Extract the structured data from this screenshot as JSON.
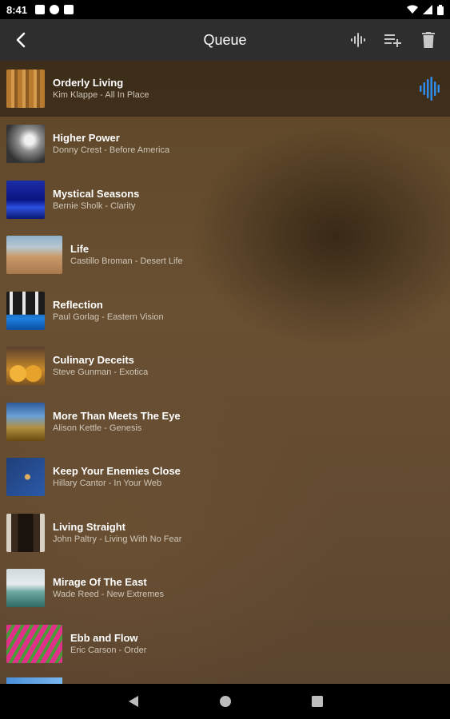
{
  "status": {
    "time": "8:41"
  },
  "appbar": {
    "title": "Queue"
  },
  "queue": [
    {
      "title": "Orderly Living",
      "subtitle": "Kim Klappe - All In Place",
      "current": true
    },
    {
      "title": "Higher Power",
      "subtitle": "Donny Crest - Before America"
    },
    {
      "title": "Mystical Seasons",
      "subtitle": "Bernie Sholk - Clarity"
    },
    {
      "title": "Life",
      "subtitle": "Castillo Broman - Desert Life"
    },
    {
      "title": "Reflection",
      "subtitle": "Paul Gorlag - Eastern Vision"
    },
    {
      "title": "Culinary Deceits",
      "subtitle": "Steve Gunman - Exotica"
    },
    {
      "title": "More Than Meets The Eye",
      "subtitle": "Alison Kettle - Genesis"
    },
    {
      "title": "Keep Your Enemies Close",
      "subtitle": "Hillary Cantor - In Your Web"
    },
    {
      "title": "Living Straight",
      "subtitle": "John Paltry - Living With No Fear"
    },
    {
      "title": "Mirage Of The East",
      "subtitle": "Wade Reed - New Extremes"
    },
    {
      "title": "Ebb and Flow",
      "subtitle": "Eric Carson - Order"
    }
  ],
  "colors": {
    "accent": "#2f8bea",
    "appbar": "#2e2e2e"
  },
  "icons": {
    "back": "arrow-back-icon",
    "equalizer": "equalizer-icon",
    "add_to_playlist": "playlist-add-icon",
    "delete": "trash-icon",
    "now_playing": "now-playing-bars-icon"
  }
}
